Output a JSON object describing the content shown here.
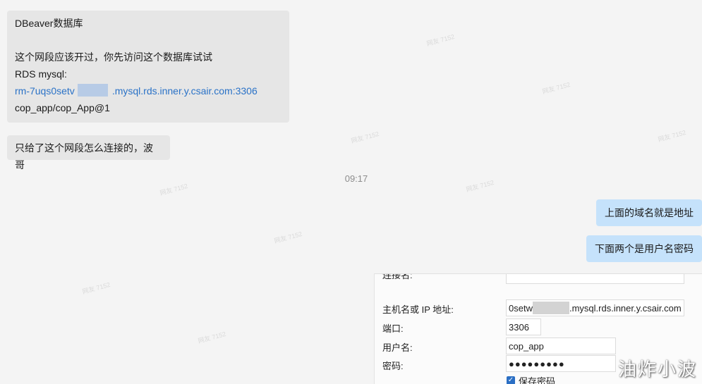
{
  "messages": {
    "m1": {
      "title": "DBeaver数据库",
      "line1": "这个网段应该开过，你先访问这个数据库试试",
      "line2": "RDS mysql:",
      "link_prefix": "rm-7uqs0setv",
      "link_suffix": ".mysql.rds.inner.y.csair.com:3306",
      "creds": "cop_app/cop_App@1"
    },
    "m2": "只给了这个网段怎么连接的，波哥",
    "time": "09:17",
    "out1": "上面的域名就是地址",
    "out2": "下面两个是用户名密码"
  },
  "watermark": "网友 7152",
  "form": {
    "host_label": "主机名或 IP 地址:",
    "host_prefix": "0setw",
    "host_suffix": ".mysql.rds.inner.y.csair.com",
    "port_label": "端口:",
    "port_value": "3306",
    "user_label": "用户名:",
    "user_value": "cop_app",
    "pwd_label": "密码:",
    "pwd_value": "●●●●●●●●●",
    "save_label": "保存密码"
  },
  "brand": "油炸小波",
  "colors": {
    "incoming": "#e6e6e6",
    "outgoing": "#c5e2fb",
    "link": "#2a72c7",
    "accent": "#2b6fc4"
  }
}
